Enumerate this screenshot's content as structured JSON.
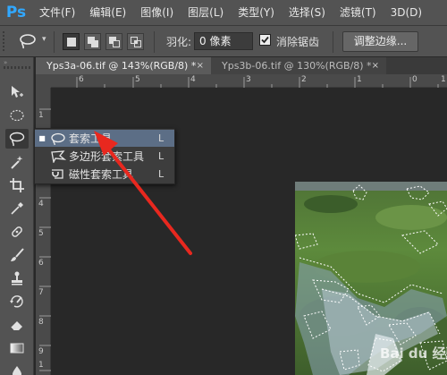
{
  "app": {
    "logo": "Ps"
  },
  "menubar": {
    "items": [
      "文件(F)",
      "编辑(E)",
      "图像(I)",
      "图层(L)",
      "类型(Y)",
      "选择(S)",
      "滤镜(T)",
      "3D(D)"
    ]
  },
  "options": {
    "feather_label": "羽化:",
    "feather_value": "0 像素",
    "antialias_label": "消除锯齿",
    "antialias_checked": true,
    "refine_edge_label": "调整边缘..."
  },
  "tabs": [
    {
      "label": "Yps3a-06.tif @ 143%(RGB/8) *",
      "close": "×",
      "active": true
    },
    {
      "label": "Yps3b-06.tif @ 130%(RGB/8) *",
      "close": "×",
      "active": false
    }
  ],
  "ruler": {
    "h": [
      "6",
      "5",
      "4",
      "3",
      "2",
      "1",
      "0",
      "1"
    ],
    "v": [
      "1",
      "2",
      "3",
      "4",
      "5",
      "6",
      "7",
      "8",
      "9",
      "1"
    ]
  },
  "lasso_flyout": {
    "items": [
      {
        "label": "套索工具",
        "shortcut": "L",
        "selected": true,
        "icon": "lasso-icon"
      },
      {
        "label": "多边形套索工具",
        "shortcut": "L",
        "selected": false,
        "icon": "polygonal-lasso-icon"
      },
      {
        "label": "磁性套索工具",
        "shortcut": "L",
        "selected": false,
        "icon": "magnetic-lasso-icon"
      }
    ]
  },
  "watermark": "Bai du 经验",
  "colors": {
    "accent": "#31a8ff",
    "flyout_highlight": "#5c6e86",
    "arrow": "#e8281f"
  }
}
